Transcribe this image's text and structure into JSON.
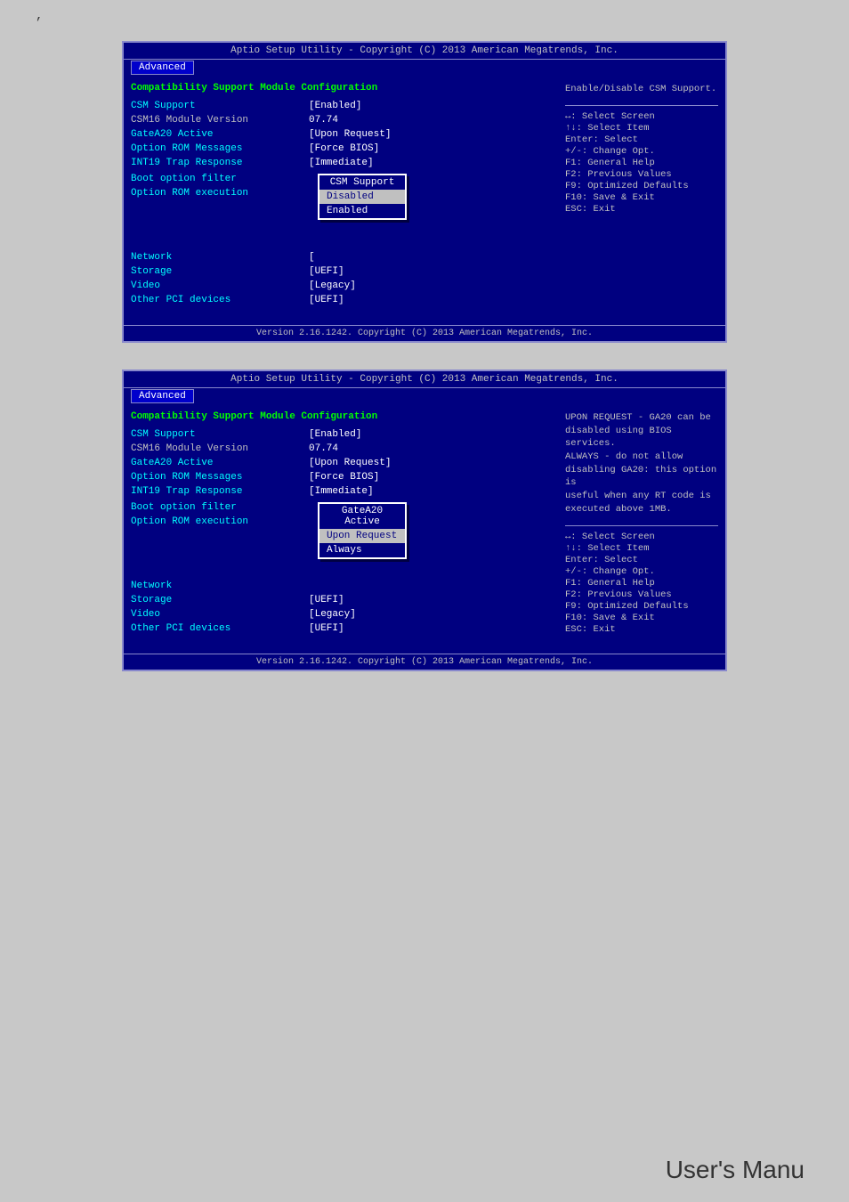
{
  "comma": ",",
  "screen1": {
    "header": "Aptio Setup Utility - Copyright (C) 2013 American Megatrends, Inc.",
    "tab": "Advanced",
    "section_title": "Compatibility Support Module Configuration",
    "help_right": "Enable/Disable CSM Support.",
    "rows": [
      {
        "label": "CSM Support",
        "value": "[Enabled]"
      },
      {
        "label": "CSM16 Module Version",
        "value": "07.74"
      }
    ],
    "group1_labels": [
      "GateA20 Active",
      "Option ROM Messages",
      "INT19 Trap Response"
    ],
    "group1_values": [
      "[Upon Request]",
      "[Force BIOS]",
      "[Immediate]"
    ],
    "row_boot": {
      "label": "Boot option filter",
      "value": ""
    },
    "row_option": {
      "label": "Option ROM execution",
      "value": ""
    },
    "popup": {
      "title": "CSM Support",
      "items": [
        "Disabled",
        "Enabled"
      ],
      "selected": 1
    },
    "rows2_labels": [
      "Network",
      "Storage",
      "Video",
      "Other PCI devices"
    ],
    "rows2_values": [
      "[",
      "[UEFI]",
      "[Legacy]",
      "[UEFI]"
    ],
    "help_keys": [
      "↔: Select Screen",
      "↑↓: Select Item",
      "Enter: Select",
      "+/-: Change Opt.",
      "F1: General Help",
      "F2: Previous Values",
      "F9: Optimized Defaults",
      "F10: Save & Exit",
      "ESC: Exit"
    ],
    "footer": "Version 2.16.1242. Copyright (C) 2013 American Megatrends, Inc."
  },
  "screen2": {
    "header": "Aptio Setup Utility - Copyright (C) 2013 American Megatrends, Inc.",
    "tab": "Advanced",
    "section_title": "Compatibility Support Module Configuration",
    "help_right": "UPON REQUEST - GA20 can be\ndisabled using BIOS services.\nALWAYS - do not allow\ndisabling GA20: this option is\nuseful when any RT code is\nexecuted above 1MB.",
    "rows": [
      {
        "label": "CSM Support",
        "value": "[Enabled]"
      },
      {
        "label": "CSM16 Module Version",
        "value": "07.74"
      }
    ],
    "group1_labels": [
      "GateA20 Active",
      "Option ROM Messages",
      "INT19 Trap Response"
    ],
    "group1_values": [
      "[Upon Request]",
      "[Force BIOS]",
      "[Immediate]"
    ],
    "row_boot": {
      "label": "Boot option filter",
      "value": ""
    },
    "row_option": {
      "label": "Option ROM execution",
      "value": ""
    },
    "popup": {
      "title": "GateA20 Active",
      "items": [
        "Upon Request",
        "Always"
      ],
      "selected": 1
    },
    "rows2_labels": [
      "Network",
      "Storage",
      "Video",
      "Other PCI devices"
    ],
    "rows2_values": [
      "",
      "[UEFI]",
      "[Legacy]",
      "[UEFI]"
    ],
    "help_keys": [
      "↔: Select Screen",
      "↑↓: Select Item",
      "Enter: Select",
      "+/-: Change Opt.",
      "F1: General Help",
      "F2: Previous Values",
      "F9: Optimized Defaults",
      "F10: Save & Exit",
      "ESC: Exit"
    ],
    "footer": "Version 2.16.1242. Copyright (C) 2013 American Megatrends, Inc."
  },
  "users_manu": "User's Manu"
}
